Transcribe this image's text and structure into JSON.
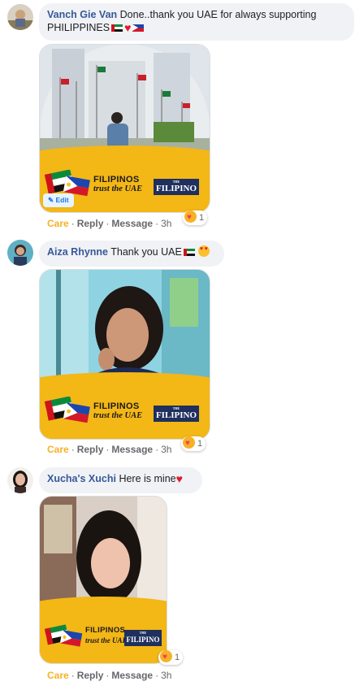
{
  "comments": [
    {
      "author": "Vanch Gie Van",
      "text": "Done..thank you UAE for always supporting PHILIPPINES",
      "frame": {
        "line1": "FILIPINOS",
        "line2": "trust the UAE",
        "logo": "FILIPINO",
        "logo_small": "THE"
      },
      "edit_label": "Edit",
      "actions": {
        "care": "Care",
        "reply": "Reply",
        "message": "Message",
        "time": "3h"
      },
      "reaction_count": "1"
    },
    {
      "author": "Aiza Rhynne",
      "text": "Thank you UAE",
      "frame": {
        "line1": "FILIPINOS",
        "line2": "trust the UAE",
        "logo": "FILIPINO",
        "logo_small": "THE"
      },
      "actions": {
        "care": "Care",
        "reply": "Reply",
        "message": "Message",
        "time": "3h"
      },
      "reaction_count": "1"
    },
    {
      "author": "Xucha's Xuchi",
      "text": "Here is mine",
      "frame": {
        "line1": "FILIPINOS",
        "line2": "trust the UAE",
        "logo": "FILIPINO",
        "logo_small": "THE"
      },
      "actions": {
        "care": "Care",
        "reply": "Reply",
        "message": "Message",
        "time": "3h"
      },
      "reaction_count": "1"
    }
  ],
  "separator": "·",
  "colors": {
    "author": "#385898",
    "bubble": "#f0f2f5",
    "care": "#f7b125",
    "frame_yellow": "#f3b716",
    "logo_navy": "#1f2f5e"
  },
  "icons": [
    "uae-flag-icon",
    "philippines-flag-icon",
    "heart-icon",
    "heart-eyes-icon",
    "care-reaction-icon",
    "pencil-icon"
  ]
}
